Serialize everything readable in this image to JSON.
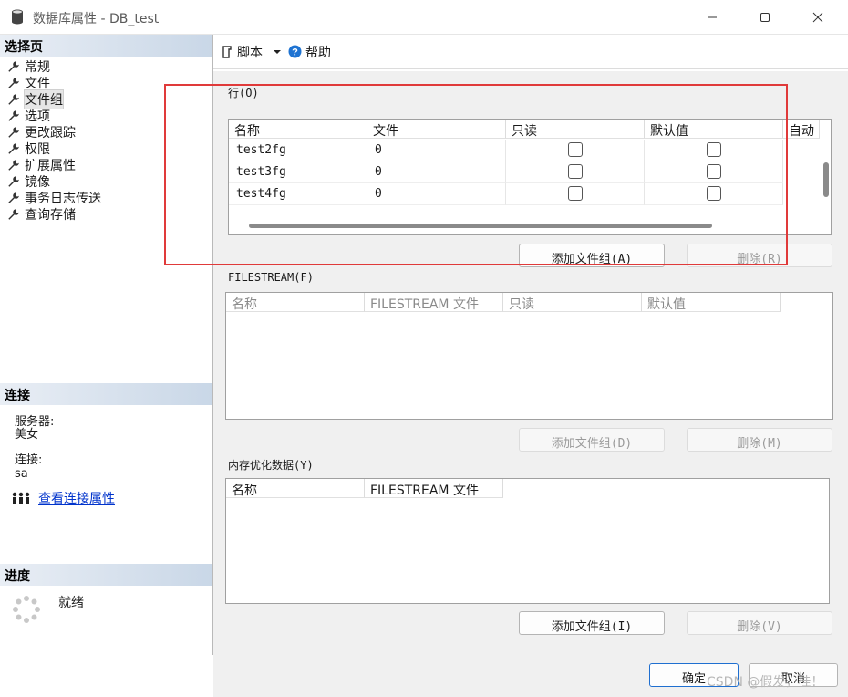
{
  "window": {
    "title": "数据库属性 - DB_test",
    "minimize_icon": "minimize-icon",
    "maximize_icon": "maximize-icon",
    "close_icon": "close-icon"
  },
  "left": {
    "select_page_header": "选择页",
    "nav_items": [
      {
        "label": "常规",
        "icon": "wrench-icon"
      },
      {
        "label": "文件",
        "icon": "wrench-icon"
      },
      {
        "label": "文件组",
        "icon": "wrench-icon",
        "selected": true
      },
      {
        "label": "选项",
        "icon": "wrench-icon"
      },
      {
        "label": "更改跟踪",
        "icon": "wrench-icon"
      },
      {
        "label": "权限",
        "icon": "wrench-icon"
      },
      {
        "label": "扩展属性",
        "icon": "wrench-icon"
      },
      {
        "label": "镜像",
        "icon": "wrench-icon"
      },
      {
        "label": "事务日志传送",
        "icon": "wrench-icon"
      },
      {
        "label": "查询存储",
        "icon": "wrench-icon"
      }
    ],
    "connection_header": "连接",
    "server_label": "服务器:",
    "server_value": "美女",
    "connection_label": "连接:",
    "connection_value": "sa",
    "view_connection_link": "查看连接属性",
    "progress_header": "进度",
    "progress_status": "就绪"
  },
  "toolbar": {
    "script_label": "脚本",
    "help_label": "帮助"
  },
  "rows_group": {
    "label": "行(O)",
    "columns": [
      "名称",
      "文件",
      "只读",
      "默认值",
      "自动"
    ],
    "rows": [
      {
        "name": "test2fg",
        "files": "0",
        "readonly": false,
        "default": false
      },
      {
        "name": "test3fg",
        "files": "0",
        "readonly": false,
        "default": false
      },
      {
        "name": "test4fg",
        "files": "0",
        "readonly": false,
        "default": false
      }
    ],
    "add_button": "添加文件组(A)",
    "remove_button": "删除(R)"
  },
  "filestream_group": {
    "label": "FILESTREAM(F)",
    "columns": [
      "名称",
      "FILESTREAM 文件",
      "只读",
      "默认值"
    ],
    "add_button": "添加文件组(D)",
    "remove_button": "删除(M)"
  },
  "memory_group": {
    "label": "内存优化数据(Y)",
    "columns": [
      "名称",
      "FILESTREAM 文件"
    ],
    "add_button": "添加文件组(I)",
    "remove_button": "删除(V)"
  },
  "footer": {
    "ok_button": "确定",
    "cancel_button": "取消"
  },
  "watermark": "CSDN @假发，桂！",
  "colors": {
    "highlight_box": "#e03a3a",
    "link": "#0033cc",
    "header_gradient_end": "#c9d7e7"
  }
}
